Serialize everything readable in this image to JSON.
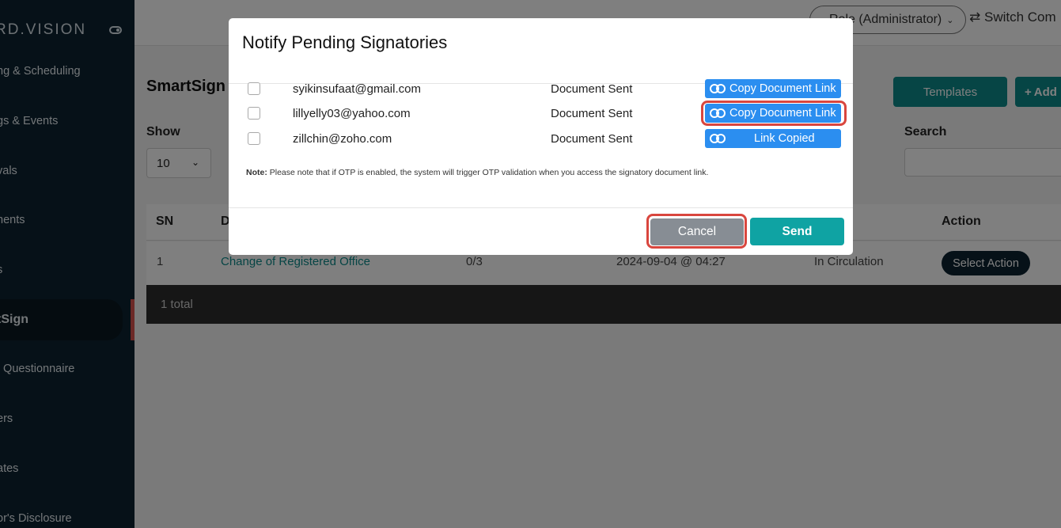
{
  "sidebar": {
    "brand": "RD.VISION",
    "items": [
      {
        "label": "ng & Scheduling"
      },
      {
        "label": "gs & Events"
      },
      {
        "label": "vals"
      },
      {
        "label": "nents"
      },
      {
        "label": "s"
      },
      {
        "label": "tSign"
      },
      {
        "label": "/ Questionnaire"
      },
      {
        "label": "ers"
      },
      {
        "label": "ates"
      },
      {
        "label": "or's Disclosure"
      }
    ]
  },
  "topbar": {
    "role": "Role (Administrator)",
    "switch": "Switch Com"
  },
  "main": {
    "title": "SmartSign",
    "templates_label": "Templates",
    "add_label": "Add",
    "show_label": "Show",
    "show_value": "10",
    "search_label": "Search",
    "table": {
      "headers": {
        "sn": "SN",
        "doc": "D",
        "action": "Action"
      },
      "rows": [
        {
          "sn": "1",
          "document": "Change of Registered Office",
          "progress": "0/3",
          "date": "2024-09-04 @ 04:27",
          "status": "In Circulation",
          "action": "Select Action"
        }
      ],
      "footer": "1 total"
    }
  },
  "modal": {
    "title": "Notify Pending Signatories",
    "signatories": [
      {
        "email": "syikinsufaat@gmail.com",
        "status": "Document Sent",
        "button": "Copy Document Link"
      },
      {
        "email": "lillyelly03@yahoo.com",
        "status": "Document Sent",
        "button": "Copy Document Link"
      },
      {
        "email": "zillchin@zoho.com",
        "status": "Document Sent",
        "button": "Link Copied"
      }
    ],
    "note_label": "Note:",
    "note_text": " Please note that if OTP is enabled, the system will trigger OTP validation when you access the signatory document link.",
    "cancel_label": "Cancel",
    "send_label": "Send"
  },
  "colors": {
    "sidebar": "#0c2230",
    "teal": "#0d8a8a",
    "link_button": "#2b8ef0",
    "highlight": "#d9463e"
  }
}
